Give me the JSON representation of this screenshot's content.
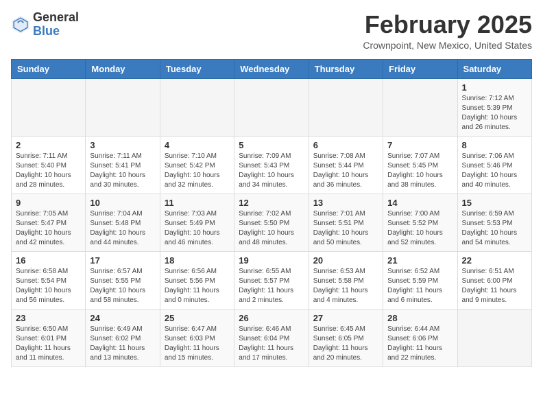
{
  "header": {
    "logo_general": "General",
    "logo_blue": "Blue",
    "month_title": "February 2025",
    "location": "Crownpoint, New Mexico, United States"
  },
  "days_of_week": [
    "Sunday",
    "Monday",
    "Tuesday",
    "Wednesday",
    "Thursday",
    "Friday",
    "Saturday"
  ],
  "weeks": [
    [
      {
        "day": "",
        "info": ""
      },
      {
        "day": "",
        "info": ""
      },
      {
        "day": "",
        "info": ""
      },
      {
        "day": "",
        "info": ""
      },
      {
        "day": "",
        "info": ""
      },
      {
        "day": "",
        "info": ""
      },
      {
        "day": "1",
        "info": "Sunrise: 7:12 AM\nSunset: 5:39 PM\nDaylight: 10 hours and 26 minutes."
      }
    ],
    [
      {
        "day": "2",
        "info": "Sunrise: 7:11 AM\nSunset: 5:40 PM\nDaylight: 10 hours and 28 minutes."
      },
      {
        "day": "3",
        "info": "Sunrise: 7:11 AM\nSunset: 5:41 PM\nDaylight: 10 hours and 30 minutes."
      },
      {
        "day": "4",
        "info": "Sunrise: 7:10 AM\nSunset: 5:42 PM\nDaylight: 10 hours and 32 minutes."
      },
      {
        "day": "5",
        "info": "Sunrise: 7:09 AM\nSunset: 5:43 PM\nDaylight: 10 hours and 34 minutes."
      },
      {
        "day": "6",
        "info": "Sunrise: 7:08 AM\nSunset: 5:44 PM\nDaylight: 10 hours and 36 minutes."
      },
      {
        "day": "7",
        "info": "Sunrise: 7:07 AM\nSunset: 5:45 PM\nDaylight: 10 hours and 38 minutes."
      },
      {
        "day": "8",
        "info": "Sunrise: 7:06 AM\nSunset: 5:46 PM\nDaylight: 10 hours and 40 minutes."
      }
    ],
    [
      {
        "day": "9",
        "info": "Sunrise: 7:05 AM\nSunset: 5:47 PM\nDaylight: 10 hours and 42 minutes."
      },
      {
        "day": "10",
        "info": "Sunrise: 7:04 AM\nSunset: 5:48 PM\nDaylight: 10 hours and 44 minutes."
      },
      {
        "day": "11",
        "info": "Sunrise: 7:03 AM\nSunset: 5:49 PM\nDaylight: 10 hours and 46 minutes."
      },
      {
        "day": "12",
        "info": "Sunrise: 7:02 AM\nSunset: 5:50 PM\nDaylight: 10 hours and 48 minutes."
      },
      {
        "day": "13",
        "info": "Sunrise: 7:01 AM\nSunset: 5:51 PM\nDaylight: 10 hours and 50 minutes."
      },
      {
        "day": "14",
        "info": "Sunrise: 7:00 AM\nSunset: 5:52 PM\nDaylight: 10 hours and 52 minutes."
      },
      {
        "day": "15",
        "info": "Sunrise: 6:59 AM\nSunset: 5:53 PM\nDaylight: 10 hours and 54 minutes."
      }
    ],
    [
      {
        "day": "16",
        "info": "Sunrise: 6:58 AM\nSunset: 5:54 PM\nDaylight: 10 hours and 56 minutes."
      },
      {
        "day": "17",
        "info": "Sunrise: 6:57 AM\nSunset: 5:55 PM\nDaylight: 10 hours and 58 minutes."
      },
      {
        "day": "18",
        "info": "Sunrise: 6:56 AM\nSunset: 5:56 PM\nDaylight: 11 hours and 0 minutes."
      },
      {
        "day": "19",
        "info": "Sunrise: 6:55 AM\nSunset: 5:57 PM\nDaylight: 11 hours and 2 minutes."
      },
      {
        "day": "20",
        "info": "Sunrise: 6:53 AM\nSunset: 5:58 PM\nDaylight: 11 hours and 4 minutes."
      },
      {
        "day": "21",
        "info": "Sunrise: 6:52 AM\nSunset: 5:59 PM\nDaylight: 11 hours and 6 minutes."
      },
      {
        "day": "22",
        "info": "Sunrise: 6:51 AM\nSunset: 6:00 PM\nDaylight: 11 hours and 9 minutes."
      }
    ],
    [
      {
        "day": "23",
        "info": "Sunrise: 6:50 AM\nSunset: 6:01 PM\nDaylight: 11 hours and 11 minutes."
      },
      {
        "day": "24",
        "info": "Sunrise: 6:49 AM\nSunset: 6:02 PM\nDaylight: 11 hours and 13 minutes."
      },
      {
        "day": "25",
        "info": "Sunrise: 6:47 AM\nSunset: 6:03 PM\nDaylight: 11 hours and 15 minutes."
      },
      {
        "day": "26",
        "info": "Sunrise: 6:46 AM\nSunset: 6:04 PM\nDaylight: 11 hours and 17 minutes."
      },
      {
        "day": "27",
        "info": "Sunrise: 6:45 AM\nSunset: 6:05 PM\nDaylight: 11 hours and 20 minutes."
      },
      {
        "day": "28",
        "info": "Sunrise: 6:44 AM\nSunset: 6:06 PM\nDaylight: 11 hours and 22 minutes."
      },
      {
        "day": "",
        "info": ""
      }
    ]
  ]
}
